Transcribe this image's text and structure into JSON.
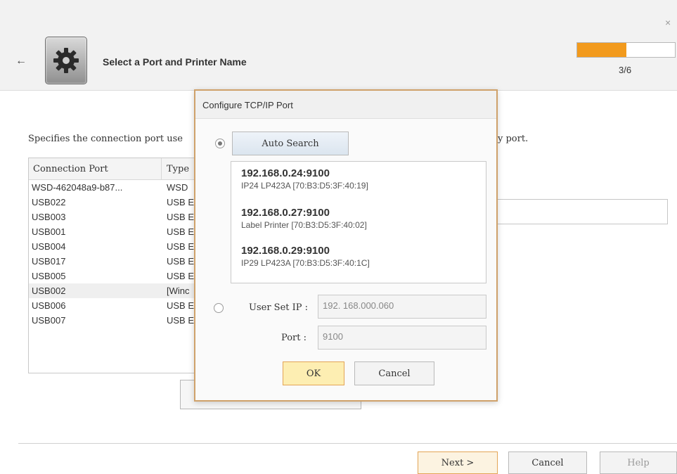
{
  "window": {
    "close_glyph": "×"
  },
  "header": {
    "back_glyph": "←",
    "title": "Select a Port and Printer Name",
    "progress": {
      "value": 0.5,
      "label": "3/6",
      "color": "#f29a1d"
    }
  },
  "main": {
    "description": "Specifies the connection port use",
    "description_tail": "y port.",
    "table": {
      "columns": [
        "Connection Port",
        "Type"
      ],
      "rows": [
        [
          "WSD-462048a9-b87...",
          "WSD"
        ],
        [
          "USB022",
          "USB E"
        ],
        [
          "USB003",
          "USB E"
        ],
        [
          "USB001",
          "USB E"
        ],
        [
          "USB004",
          "USB E"
        ],
        [
          "USB017",
          "USB E"
        ],
        [
          "USB005",
          "USB E"
        ],
        [
          "USB002",
          "[Winc"
        ],
        [
          "USB006",
          "USB E"
        ],
        [
          "USB007",
          "USB E"
        ]
      ],
      "selected_index": 7
    }
  },
  "dialog": {
    "title": "Configure TCP/IP Port",
    "auto_search_label": "Auto Search",
    "devices": [
      {
        "ip": "192.168.0.24:9100",
        "info": "IP24 LP423A [70:B3:D5:3F:40:19]"
      },
      {
        "ip": "192.168.0.27:9100",
        "info": "Label Printer [70:B3:D5:3F:40:02]"
      },
      {
        "ip": "192.168.0.29:9100",
        "info": "IP29 LP423A [70:B3:D5:3F:40:1C]"
      }
    ],
    "user_set_ip_label": "User Set IP :",
    "user_set_ip_value": "192. 168.000.060",
    "port_label": "Port :",
    "port_value": "9100",
    "ok_label": "OK",
    "cancel_label": "Cancel"
  },
  "footer": {
    "next_label": "Next >",
    "cancel_label": "Cancel",
    "help_label": "Help"
  }
}
